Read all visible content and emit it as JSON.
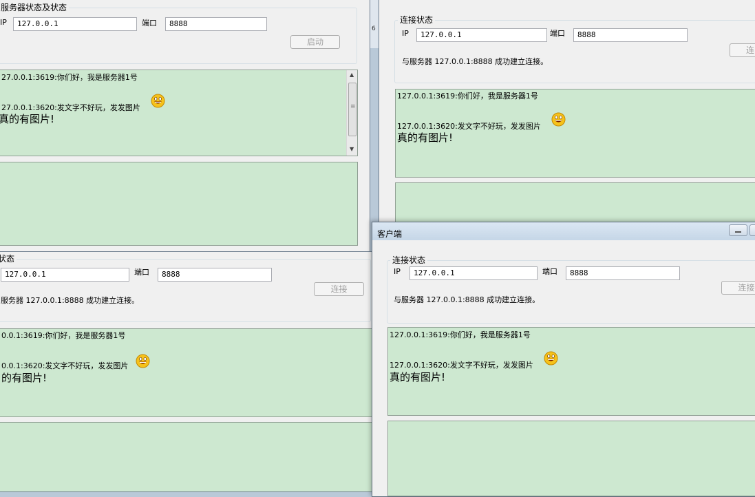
{
  "server": {
    "group_label": "服务器状态及状态",
    "ip_label": "IP",
    "ip_value": "127.0.0.1",
    "port_label": "端口",
    "port_value": "8888",
    "start_button": "启动"
  },
  "client": {
    "title": "客户端",
    "group_label": "连接状态",
    "ip_label": "IP",
    "ip_value": "127.0.0.1",
    "port_label": "端口",
    "port_value": "8888",
    "connect_button": "连接",
    "status_text": "与服务器 127.0.0.1:8888 成功建立连接。"
  },
  "partial": {
    "group_label_fragment": "状态",
    "connect_fragment": "连",
    "status_text_fragment": "服务器 127.0.0.1:8888 成功建立连接。"
  },
  "messages": {
    "msg1": "127.0.0.1:3619:你们好，我是服务器1号",
    "msg2": "127.0.0.1:3620:发文字不好玩，发发图片",
    "msg3": "真的有图片!",
    "msg1_fragment": "27.0.0.1:3619:你们好，我是服务器1号",
    "msg2_fragment": "27.0.0.1:3620:发文字不好玩，发发图片",
    "msg3_fragment": "真的有图片!",
    "msg1_fragment2": "0.0.1:3619:你们好，我是服务器1号",
    "msg2_fragment2": "0.0.1:3620:发文字不好玩，发发图片",
    "msg3_fragment2": "的有图片!"
  },
  "misc": {
    "edge_digit": "6"
  },
  "icons": [
    "smiley-emoticon-icon",
    "minimize-icon",
    "scroll-up-icon",
    "scroll-down-icon",
    "scroll-thumb-grip-icon"
  ],
  "colors": {
    "chat_bg": "#cde8d0",
    "window_bg": "#f0f0f0",
    "disabled_text": "#a0a0a0",
    "desktop": "#b9c9d8"
  }
}
